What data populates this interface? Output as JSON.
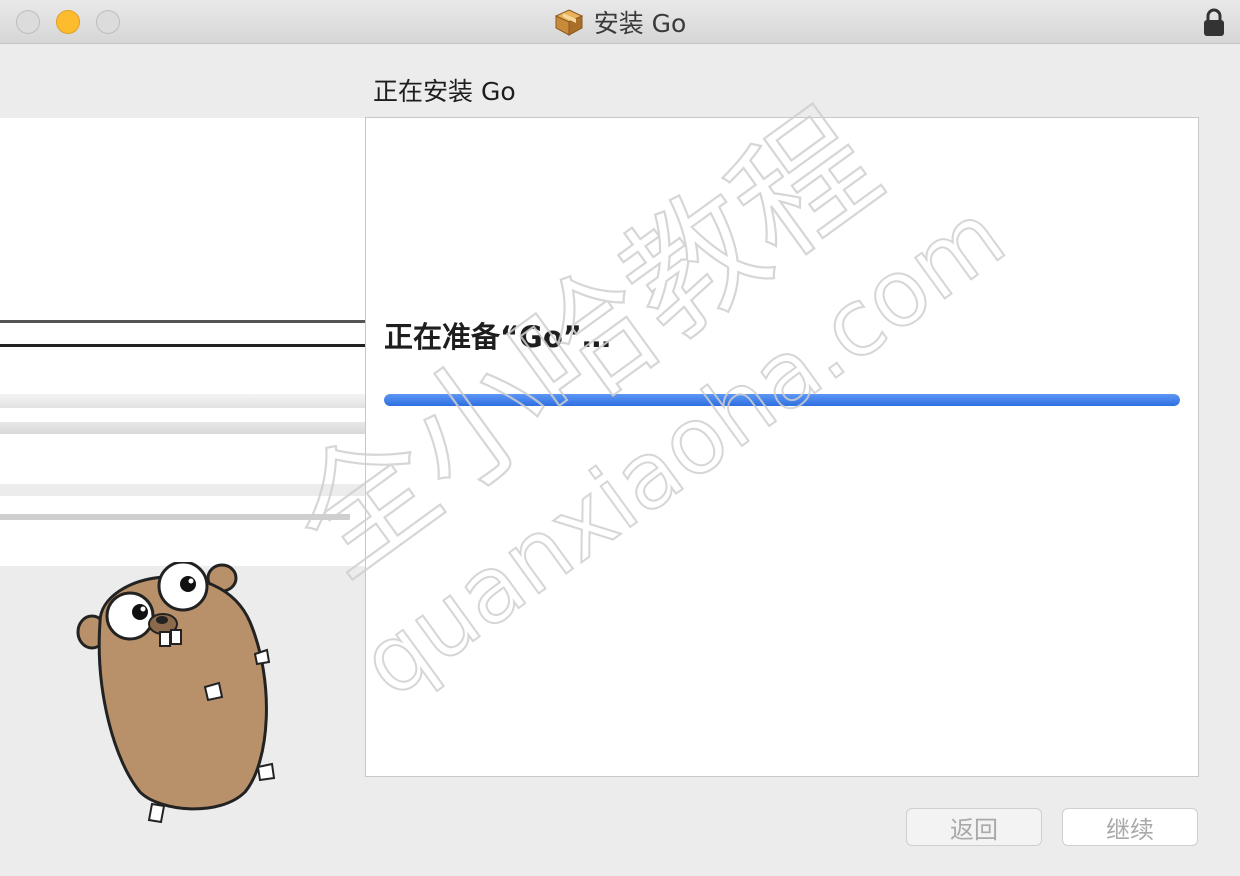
{
  "window": {
    "title": "安装 Go",
    "icons": {
      "title_icon": "package-icon",
      "lock": "lock-icon"
    },
    "traffic_lights": [
      "close",
      "minimize",
      "zoom"
    ]
  },
  "step_heading": "正在安装 Go",
  "installer": {
    "status_text": "正在准备“Go”…",
    "progress_fraction": 1.0
  },
  "buttons": {
    "back_label": "返回",
    "continue_label": "继续"
  },
  "watermark": {
    "cn_text": "全小哈教程",
    "url_text": "quanxiaoha.com"
  },
  "colors": {
    "progress": "#2e6fe0",
    "minimize": "#fdbc2e"
  }
}
